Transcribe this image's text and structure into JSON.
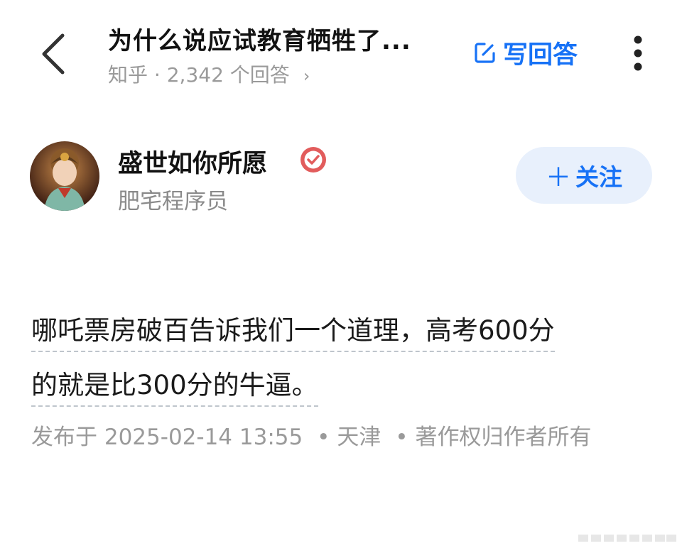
{
  "header": {
    "back_icon": "chevron-left-icon",
    "question_title": "为什么说应试教育牺牲了...",
    "source": "知乎",
    "answer_count": "2,342 个回答",
    "write_answer_label": "写回答",
    "write_icon": "edit-icon",
    "more_icon": "more-vertical-icon"
  },
  "author": {
    "name": "盛世如你所愿",
    "bio": "肥宅程序员",
    "verified_icon": "verified-badge-icon",
    "follow_label": "关注"
  },
  "answer": {
    "line1": "哪吒票房破百告诉我们一个道理，高考600分",
    "line2": "的就是比300分的牛逼。",
    "published_prefix": "发布于",
    "published_datetime": "2025-02-14  13:55",
    "location": "天津",
    "copyright": "著作权归作者所有"
  },
  "colors": {
    "accent": "#1772f6",
    "follow_bg": "#e8f0fc",
    "muted_text": "#9a9a9a"
  }
}
